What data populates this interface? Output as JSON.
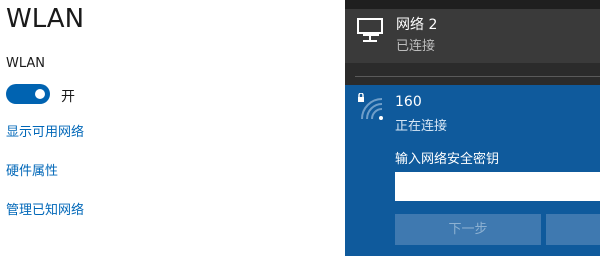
{
  "settings": {
    "title": "WLAN",
    "wlan_label": "WLAN",
    "toggle_state": "开",
    "links": [
      "显示可用网络",
      "硬件属性",
      "管理已知网络"
    ]
  },
  "flyout": {
    "wired": {
      "name": "网络 2",
      "status": "已连接",
      "icon": "ethernet-icon"
    },
    "wifi": {
      "name": "160",
      "status": "正在连接",
      "prompt": "输入网络安全密钥",
      "input_value": "",
      "next_label": "下一步",
      "cancel_label": "",
      "icon": "secured-wifi-icon"
    }
  },
  "colors": {
    "accent": "#0063b1",
    "link": "#0067b8",
    "flyout_bg": "#2b2b2b",
    "selected_bg": "#0f5a9c"
  }
}
